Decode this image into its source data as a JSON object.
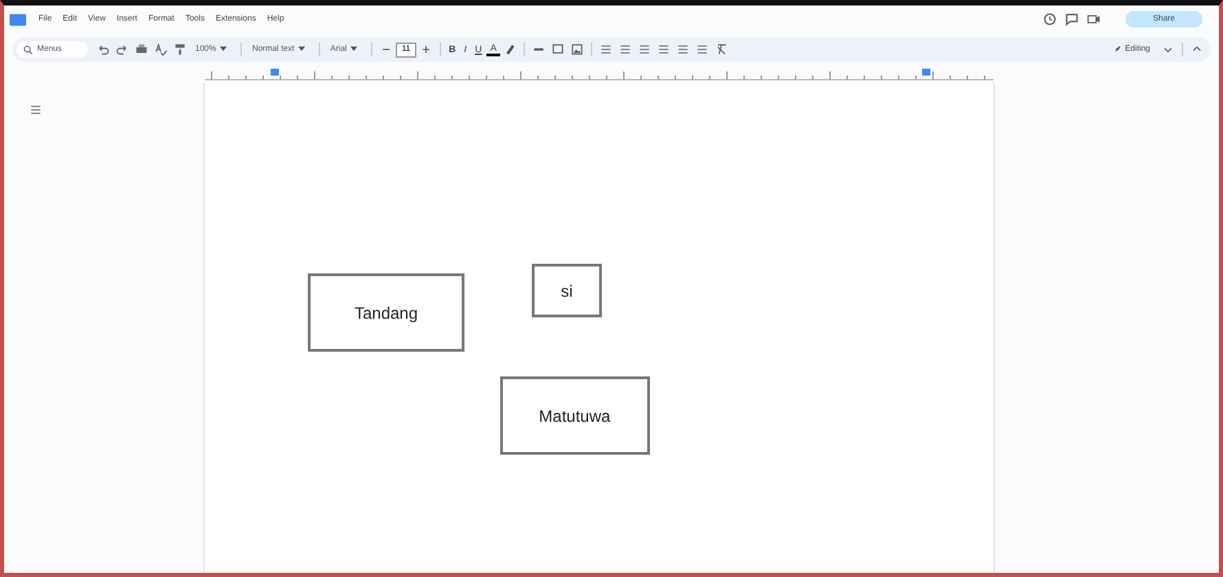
{
  "menu": [
    "File",
    "Edit",
    "View",
    "Insert",
    "Format",
    "Tools",
    "Extensions",
    "Help"
  ],
  "share": {
    "label": "Share"
  },
  "toolbar": {
    "search": "Menus",
    "zoom": "100%",
    "style": "Normal text",
    "font": "Arial",
    "font_size": "11",
    "mode": "Editing"
  },
  "format_buttons": [
    {
      "label": "B",
      "kind": "bold"
    },
    {
      "label": "I",
      "kind": "italic"
    },
    {
      "label": "U",
      "kind": "underline"
    },
    {
      "label": "A",
      "kind": "color"
    }
  ],
  "document": {
    "boxes": [
      {
        "text": "Tandang"
      },
      {
        "text": "si"
      },
      {
        "text": "Matutuwa"
      }
    ]
  }
}
